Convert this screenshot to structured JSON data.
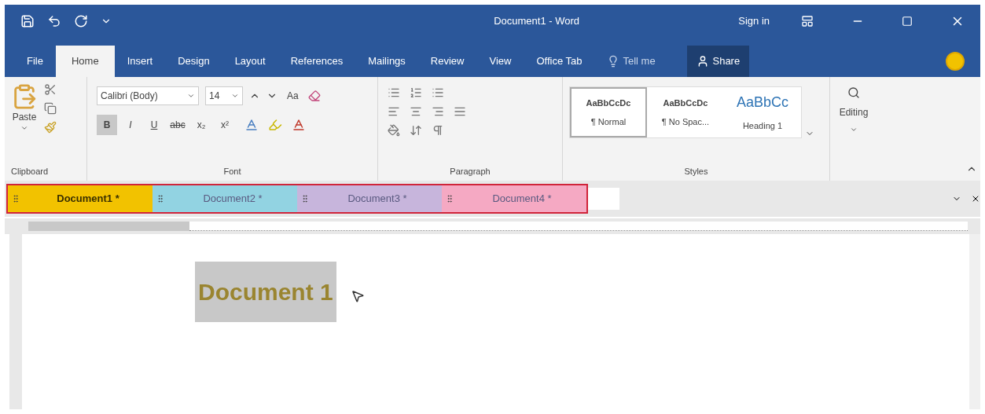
{
  "window": {
    "title": "Document1 - Word",
    "sign_in": "Sign in"
  },
  "ribbon_tabs": [
    {
      "label": "File",
      "selected": false
    },
    {
      "label": "Home",
      "selected": true
    },
    {
      "label": "Insert",
      "selected": false
    },
    {
      "label": "Design",
      "selected": false
    },
    {
      "label": "Layout",
      "selected": false
    },
    {
      "label": "References",
      "selected": false
    },
    {
      "label": "Mailings",
      "selected": false
    },
    {
      "label": "Review",
      "selected": false
    },
    {
      "label": "View",
      "selected": false
    },
    {
      "label": "Office Tab",
      "selected": false
    }
  ],
  "tell_me": {
    "placeholder": "Tell me"
  },
  "share": "Share",
  "ribbon": {
    "clipboard": {
      "paste": "Paste",
      "label": "Clipboard"
    },
    "font": {
      "font_name": "Calibri (Body)",
      "font_size": "14",
      "change_case": "Aa",
      "label": "Font",
      "formatting": [
        {
          "label": "B",
          "selected": true
        },
        {
          "label": "I",
          "selected": false
        },
        {
          "label": "U",
          "selected": false
        },
        {
          "label": "abc",
          "selected": false
        },
        {
          "label": "x₂",
          "selected": false
        },
        {
          "label": "x²",
          "selected": false
        }
      ]
    },
    "paragraph": {
      "label": "Paragraph"
    },
    "styles": {
      "label": "Styles",
      "items": [
        {
          "sample": "AaBbCcDc",
          "name": "¶ Normal",
          "selected": true
        },
        {
          "sample": "AaBbCcDc",
          "name": "¶ No Spac...",
          "selected": false
        },
        {
          "sample": "AaBbCc",
          "name": "Heading 1",
          "selected": false
        }
      ]
    },
    "editing": {
      "label": "Editing"
    }
  },
  "doc_tabs": [
    {
      "label": "Document1 *",
      "color": "#f2c200",
      "selected": true
    },
    {
      "label": "Document2 *",
      "color": "#92d3e2",
      "selected": false
    },
    {
      "label": "Document3 *",
      "color": "#c7b5dc",
      "selected": false
    },
    {
      "label": "Document4 *",
      "color": "#f5a9c3",
      "selected": false
    }
  ],
  "document": {
    "text": "Document 1",
    "selected": true
  }
}
